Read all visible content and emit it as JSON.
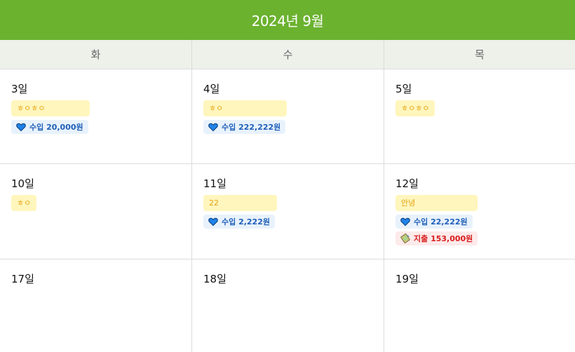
{
  "calendar": {
    "title": "2024년 9월",
    "weekdays": [
      "화",
      "수",
      "목"
    ],
    "days": [
      {
        "day": "3일",
        "note": "ㅎㅇㅎㅇ",
        "income": "수입 20,000원"
      },
      {
        "day": "4일",
        "note": "ㅎㅇ",
        "income": "수입 222,222원"
      },
      {
        "day": "5일",
        "note": "ㅎㅇㅎㅇ"
      },
      {
        "day": "10일",
        "note": "ㅎㅇ"
      },
      {
        "day": "11일",
        "note": "22",
        "income": "수입 2,222원"
      },
      {
        "day": "12일",
        "note": "안녕",
        "income": "수입 22,222원",
        "expense": "지출 153,000원"
      },
      {
        "day": "17일"
      },
      {
        "day": "18일"
      },
      {
        "day": "19일"
      }
    ]
  },
  "colors": {
    "header_bg": "#6bb22f",
    "note_bg": "#fff6bd",
    "note_text": "#e7a313",
    "income_bg": "#e8f2fc",
    "income_text": "#1e5fb8",
    "expense_bg": "#fdeaea",
    "expense_text": "#d81c1c"
  },
  "icons": {
    "income": "blue-heart-icon",
    "expense": "money-icon"
  }
}
